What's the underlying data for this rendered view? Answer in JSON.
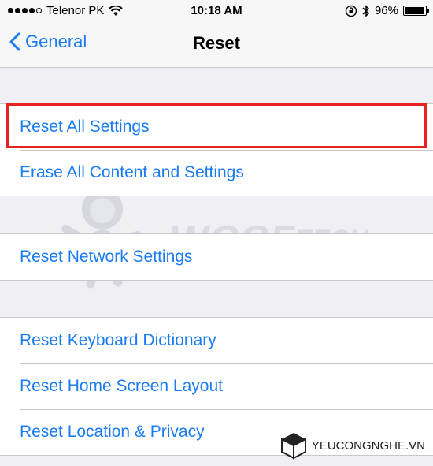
{
  "status_bar": {
    "carrier": "Telenor PK",
    "time": "10:18 AM",
    "battery_percent": "96%",
    "battery_level": 0.96,
    "signal_bars_filled": 4,
    "signal_bars_total": 5
  },
  "nav": {
    "back_label": "General",
    "title": "Reset"
  },
  "groups": [
    {
      "items": [
        "Reset All Settings",
        "Erase All Content and Settings"
      ]
    },
    {
      "items": [
        "Reset Network Settings"
      ]
    },
    {
      "items": [
        "Reset Keyboard Dictionary",
        "Reset Home Screen Layout",
        "Reset Location & Privacy"
      ]
    }
  ],
  "highlighted_item": "Reset All Settings",
  "watermark": {
    "text_main": "WCCF",
    "text_sub": "TECH"
  },
  "logo": {
    "text": "YEUCONGNGHE.VN"
  },
  "colors": {
    "accent": "#1a7cf5",
    "highlight": "#e6231e",
    "background": "#efeff4"
  }
}
